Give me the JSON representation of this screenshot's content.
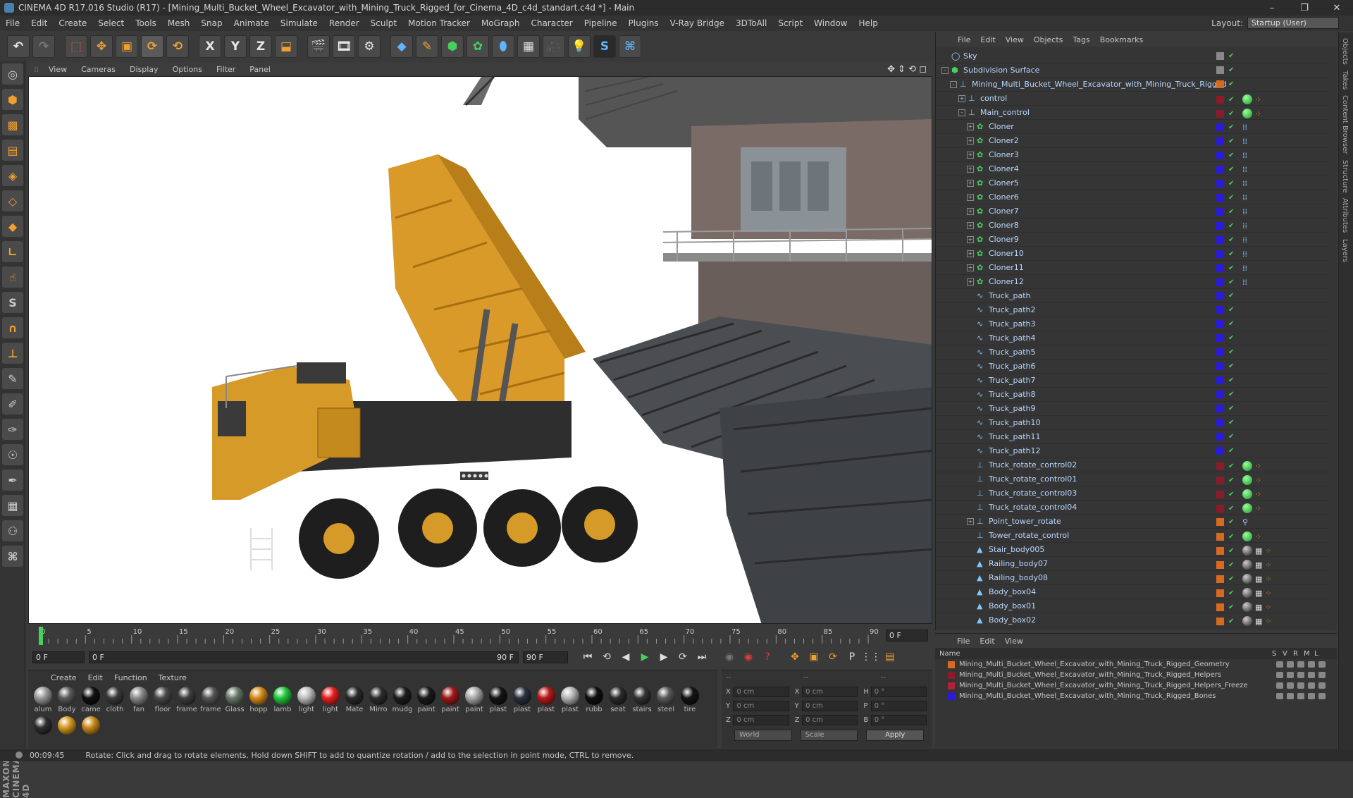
{
  "window": {
    "title": "CINEMA 4D R17.016 Studio (R17) - [Mining_Multi_Bucket_Wheel_Excavator_with_Mining_Truck_Rigged_for_Cinema_4D_c4d_standart.c4d *] - Main",
    "min": "–",
    "max": "❐",
    "close": "✕"
  },
  "menu": {
    "items": [
      "File",
      "Edit",
      "Create",
      "Select",
      "Tools",
      "Mesh",
      "Snap",
      "Animate",
      "Simulate",
      "Render",
      "Sculpt",
      "Motion Tracker",
      "MoGraph",
      "Character",
      "Pipeline",
      "Plugins",
      "V-Ray Bridge",
      "3DToAll",
      "Script",
      "Window",
      "Help"
    ],
    "layout_label": "Layout:",
    "layout_value": "Startup (User)"
  },
  "viewport_menu": {
    "items": [
      "View",
      "Cameras",
      "Display",
      "Options",
      "Filter",
      "Panel"
    ],
    "nav": "✥ ⇕ ⟲ ◻"
  },
  "timeline": {
    "ticks": [
      "0",
      "5",
      "10",
      "15",
      "20",
      "25",
      "30",
      "35",
      "40",
      "45",
      "50",
      "55",
      "60",
      "65",
      "70",
      "75",
      "80",
      "85",
      "90"
    ],
    "frame": "0 F"
  },
  "playbar": {
    "start": "0 F",
    "range_start": "0 F",
    "range_end": "90 F",
    "end": "90 F"
  },
  "materials": {
    "menu": [
      "Create",
      "Edit",
      "Function",
      "Texture"
    ],
    "items": [
      {
        "label": "alum",
        "color": "#9a9a9a"
      },
      {
        "label": "Body",
        "color": "#5a5a5a"
      },
      {
        "label": "came",
        "color": "#111111"
      },
      {
        "label": "cloth",
        "color": "#3a3a3a"
      },
      {
        "label": "fan",
        "color": "#8a8a8a"
      },
      {
        "label": "floor",
        "color": "#4a4a4a"
      },
      {
        "label": "frame",
        "color": "#3f3f3f"
      },
      {
        "label": "frame",
        "color": "#555555"
      },
      {
        "label": "Glass",
        "color": "#6a7a6a"
      },
      {
        "label": "hopp",
        "color": "#d58a1a"
      },
      {
        "label": "lamb",
        "color": "#22c83a"
      },
      {
        "label": "light",
        "color": "#bdbdbd"
      },
      {
        "label": "light",
        "color": "#e82020"
      },
      {
        "label": "Mate",
        "color": "#2a2a2a"
      },
      {
        "label": "Mirro",
        "color": "#2d2d2d"
      },
      {
        "label": "mudg",
        "color": "#1e1e1e"
      },
      {
        "label": "paint",
        "color": "#1a1a1a"
      },
      {
        "label": "paint",
        "color": "#a01818"
      },
      {
        "label": "paint",
        "color": "#a9a9a9"
      },
      {
        "label": "plast",
        "color": "#151515"
      },
      {
        "label": "plast",
        "color": "#2a3040"
      },
      {
        "label": "plast",
        "color": "#b81a1a"
      },
      {
        "label": "plast",
        "color": "#b5b5b5"
      },
      {
        "label": "rubb",
        "color": "#0f0f0f"
      },
      {
        "label": "seat",
        "color": "#2a2a2a"
      },
      {
        "label": "stairs",
        "color": "#333333"
      },
      {
        "label": "steel",
        "color": "#5a5a5a"
      },
      {
        "label": "tire",
        "color": "#141414"
      },
      {
        "label": "",
        "color": "#2e2e2e"
      },
      {
        "label": "",
        "color": "#d59a20"
      },
      {
        "label": "",
        "color": "#c88a1a"
      }
    ]
  },
  "coords": {
    "header_left": "--",
    "header_mid": "--",
    "header_right": "--",
    "rows": [
      {
        "a": "X",
        "av": "0 cm",
        "b": "X",
        "bv": "0 cm",
        "c": "H",
        "cv": "0 °"
      },
      {
        "a": "Y",
        "av": "0 cm",
        "b": "Y",
        "bv": "0 cm",
        "c": "P",
        "cv": "0 °"
      },
      {
        "a": "Z",
        "av": "0 cm",
        "b": "Z",
        "bv": "0 cm",
        "c": "B",
        "cv": "0 °"
      }
    ],
    "world": "World",
    "scale": "Scale",
    "apply": "Apply"
  },
  "objmgr": {
    "menu": [
      "File",
      "Edit",
      "View",
      "Objects",
      "Tags",
      "Bookmarks"
    ],
    "rows": [
      {
        "name": "Sky",
        "indent": 0,
        "exp": "",
        "icon": "sky-icon",
        "col": "#888888",
        "tag": ""
      },
      {
        "name": "Subdivision Surface",
        "indent": 0,
        "exp": "-",
        "icon": "subdivision-icon",
        "col": "#888888",
        "tag": ""
      },
      {
        "name": "Mining_Multi_Bucket_Wheel_Excavator_with_Mining_Truck_Rigged",
        "indent": 1,
        "exp": "-",
        "icon": "null-icon",
        "col": "#d86a20",
        "tag": ""
      },
      {
        "name": "control",
        "indent": 2,
        "exp": "+",
        "icon": "null-icon",
        "col": "#8b1a2a",
        "tag": "green"
      },
      {
        "name": "Main_control",
        "indent": 2,
        "exp": "-",
        "icon": "null-icon",
        "col": "#8b1a2a",
        "tag": "green"
      },
      {
        "name": "Cloner",
        "indent": 3,
        "exp": "+",
        "icon": "cloner-icon",
        "col": "#2a1ae0",
        "tag": "dots"
      },
      {
        "name": "Cloner2",
        "indent": 3,
        "exp": "+",
        "icon": "cloner-icon",
        "col": "#2a1ae0",
        "tag": "dots"
      },
      {
        "name": "Cloner3",
        "indent": 3,
        "exp": "+",
        "icon": "cloner-icon",
        "col": "#2a1ae0",
        "tag": "dots"
      },
      {
        "name": "Cloner4",
        "indent": 3,
        "exp": "+",
        "icon": "cloner-icon",
        "col": "#2a1ae0",
        "tag": "dots"
      },
      {
        "name": "Cloner5",
        "indent": 3,
        "exp": "+",
        "icon": "cloner-icon",
        "col": "#2a1ae0",
        "tag": "dots"
      },
      {
        "name": "Cloner6",
        "indent": 3,
        "exp": "+",
        "icon": "cloner-icon",
        "col": "#2a1ae0",
        "tag": "dots"
      },
      {
        "name": "Cloner7",
        "indent": 3,
        "exp": "+",
        "icon": "cloner-icon",
        "col": "#2a1ae0",
        "tag": "dots"
      },
      {
        "name": "Cloner8",
        "indent": 3,
        "exp": "+",
        "icon": "cloner-icon",
        "col": "#2a1ae0",
        "tag": "dots"
      },
      {
        "name": "Cloner9",
        "indent": 3,
        "exp": "+",
        "icon": "cloner-icon",
        "col": "#2a1ae0",
        "tag": "dots"
      },
      {
        "name": "Cloner10",
        "indent": 3,
        "exp": "+",
        "icon": "cloner-icon",
        "col": "#2a1ae0",
        "tag": "dots"
      },
      {
        "name": "Cloner11",
        "indent": 3,
        "exp": "+",
        "icon": "cloner-icon",
        "col": "#2a1ae0",
        "tag": "dots"
      },
      {
        "name": "Cloner12",
        "indent": 3,
        "exp": "+",
        "icon": "cloner-icon",
        "col": "#2a1ae0",
        "tag": "dots"
      },
      {
        "name": "Truck_path",
        "indent": 3,
        "exp": "",
        "icon": "spline-icon",
        "col": "#2a1ae0",
        "tag": ""
      },
      {
        "name": "Truck_path2",
        "indent": 3,
        "exp": "",
        "icon": "spline-icon",
        "col": "#2a1ae0",
        "tag": ""
      },
      {
        "name": "Truck_path3",
        "indent": 3,
        "exp": "",
        "icon": "spline-icon",
        "col": "#2a1ae0",
        "tag": ""
      },
      {
        "name": "Truck_path4",
        "indent": 3,
        "exp": "",
        "icon": "spline-icon",
        "col": "#2a1ae0",
        "tag": ""
      },
      {
        "name": "Truck_path5",
        "indent": 3,
        "exp": "",
        "icon": "spline-icon",
        "col": "#2a1ae0",
        "tag": ""
      },
      {
        "name": "Truck_path6",
        "indent": 3,
        "exp": "",
        "icon": "spline-icon",
        "col": "#2a1ae0",
        "tag": ""
      },
      {
        "name": "Truck_path7",
        "indent": 3,
        "exp": "",
        "icon": "spline-icon",
        "col": "#2a1ae0",
        "tag": ""
      },
      {
        "name": "Truck_path8",
        "indent": 3,
        "exp": "",
        "icon": "spline-icon",
        "col": "#2a1ae0",
        "tag": ""
      },
      {
        "name": "Truck_path9",
        "indent": 3,
        "exp": "",
        "icon": "spline-icon",
        "col": "#2a1ae0",
        "tag": ""
      },
      {
        "name": "Truck_path10",
        "indent": 3,
        "exp": "",
        "icon": "spline-icon",
        "col": "#2a1ae0",
        "tag": ""
      },
      {
        "name": "Truck_path11",
        "indent": 3,
        "exp": "",
        "icon": "spline-icon",
        "col": "#2a1ae0",
        "tag": ""
      },
      {
        "name": "Truck_path12",
        "indent": 3,
        "exp": "",
        "icon": "spline-icon",
        "col": "#2a1ae0",
        "tag": ""
      },
      {
        "name": "Truck_rotate_control02",
        "indent": 3,
        "exp": "",
        "icon": "null-icon",
        "col": "#8b1a2a",
        "tag": "green"
      },
      {
        "name": "Truck_rotate_control01",
        "indent": 3,
        "exp": "",
        "icon": "null-icon",
        "col": "#8b1a2a",
        "tag": "green"
      },
      {
        "name": "Truck_rotate_control03",
        "indent": 3,
        "exp": "",
        "icon": "null-icon",
        "col": "#8b1a2a",
        "tag": "green"
      },
      {
        "name": "Truck_rotate_control04",
        "indent": 3,
        "exp": "",
        "icon": "null-icon",
        "col": "#8b1a2a",
        "tag": "green"
      },
      {
        "name": "Point_tower_rotate",
        "indent": 3,
        "exp": "+",
        "icon": "null-icon",
        "col": "#d86a20",
        "tag": "bone"
      },
      {
        "name": "Tower_rotate_control",
        "indent": 3,
        "exp": "",
        "icon": "null-icon",
        "col": "#d86a20",
        "tag": "green"
      },
      {
        "name": "Stair_body005",
        "indent": 3,
        "exp": "",
        "icon": "polygon-icon",
        "col": "#d86a20",
        "tag": "mat"
      },
      {
        "name": "Railing_body07",
        "indent": 3,
        "exp": "",
        "icon": "polygon-icon",
        "col": "#d86a20",
        "tag": "mat"
      },
      {
        "name": "Railing_body08",
        "indent": 3,
        "exp": "",
        "icon": "polygon-icon",
        "col": "#d86a20",
        "tag": "mat"
      },
      {
        "name": "Body_box04",
        "indent": 3,
        "exp": "",
        "icon": "polygon-icon",
        "col": "#d86a20",
        "tag": "mat"
      },
      {
        "name": "Body_box01",
        "indent": 3,
        "exp": "",
        "icon": "polygon-icon",
        "col": "#d86a20",
        "tag": "mat"
      },
      {
        "name": "Body_box02",
        "indent": 3,
        "exp": "",
        "icon": "polygon-icon",
        "col": "#d86a20",
        "tag": "mat"
      }
    ]
  },
  "vtabs": [
    "Objects",
    "Takes",
    "Content Browser",
    "Structure",
    "Attributes",
    "Layers"
  ],
  "layermgr": {
    "menu": [
      "File",
      "Edit",
      "View"
    ],
    "head_name": "Name",
    "cols": [
      "S",
      "V",
      "R",
      "M",
      "L"
    ],
    "rows": [
      {
        "name": "Mining_Multi_Bucket_Wheel_Excavator_with_Mining_Truck_Rigged_Geometry",
        "color": "#d86a20"
      },
      {
        "name": "Mining_Multi_Bucket_Wheel_Excavator_with_Mining_Truck_Rigged_Helpers",
        "color": "#8b1a2a"
      },
      {
        "name": "Mining_Multi_Bucket_Wheel_Excavator_with_Mining_Truck_Rigged_Helpers_Freeze",
        "color": "#b0223a"
      },
      {
        "name": "Mining_Multi_Bucket_Wheel_Excavator_with_Mining_Truck_Rigged_Bones",
        "color": "#2a1ae0"
      }
    ]
  },
  "status": {
    "time": "00:09:45",
    "message": "Rotate: Click and drag to rotate elements. Hold down SHIFT to add to quantize rotation / add to the selection in point mode, CTRL to remove."
  }
}
